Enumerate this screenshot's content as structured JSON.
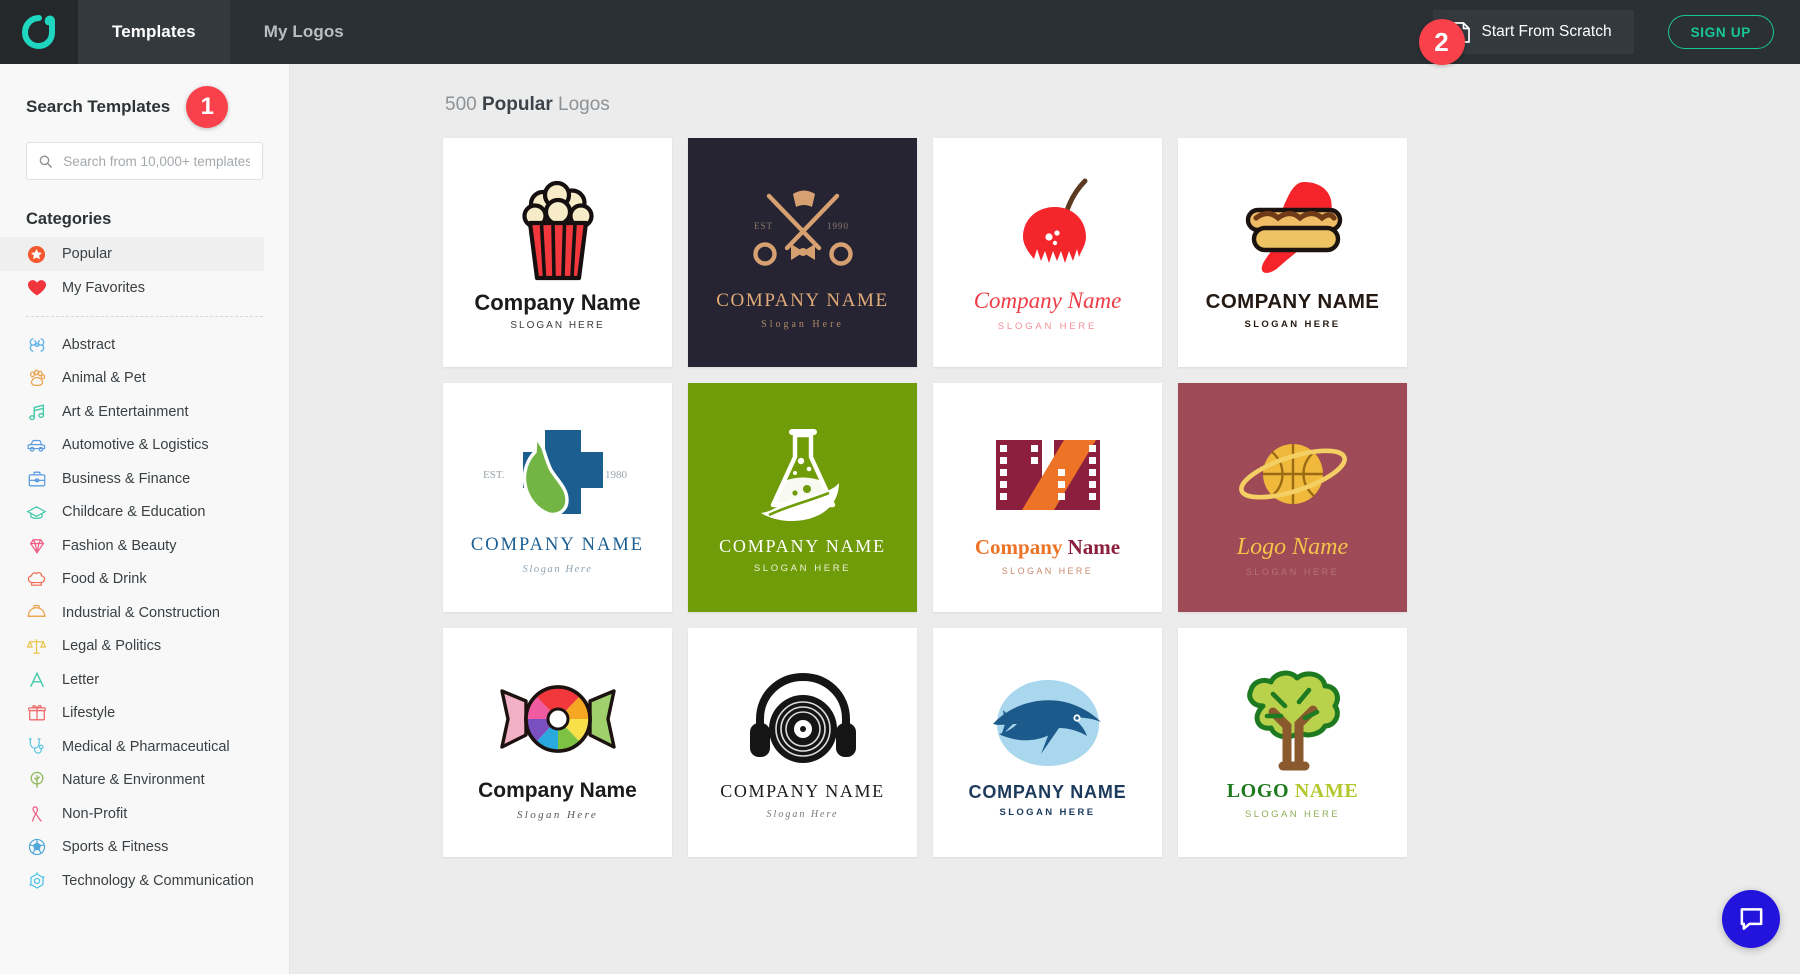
{
  "header": {
    "brand_icon": "designevo-logo-icon",
    "tabs": [
      {
        "label": "Templates",
        "active": true
      },
      {
        "label": "My Logos",
        "active": false
      }
    ],
    "badge_2": "2",
    "start_from_scratch": "Start From Scratch",
    "sign_up": "SIGN UP",
    "bg_color": "#2b3034",
    "accent_color": "#17c79a",
    "badge_color": "#f8414a"
  },
  "sidebar": {
    "title": "Search Templates",
    "badge_1": "1",
    "search": {
      "placeholder": "Search from 10,000+ templates...",
      "value": ""
    },
    "categories_title": "Categories",
    "pinned": [
      {
        "label": "Popular",
        "icon": "star-badge-icon",
        "selected": true
      },
      {
        "label": "My Favorites",
        "icon": "heart-icon",
        "selected": false
      }
    ],
    "items": [
      {
        "label": "Abstract",
        "icon": "abstract-swirl-icon",
        "color": "#63b3e8"
      },
      {
        "label": "Animal & Pet",
        "icon": "paw-print-icon",
        "color": "#eba44d"
      },
      {
        "label": "Art & Entertainment",
        "icon": "music-note-icon",
        "color": "#3fc9a8"
      },
      {
        "label": "Automotive & Logistics",
        "icon": "car-icon",
        "color": "#5d9ee0"
      },
      {
        "label": "Business & Finance",
        "icon": "briefcase-icon",
        "color": "#5d9ee0"
      },
      {
        "label": "Childcare & Education",
        "icon": "graduation-cap-icon",
        "color": "#3fc9a8"
      },
      {
        "label": "Fashion & Beauty",
        "icon": "diamond-icon",
        "color": "#ef5f86"
      },
      {
        "label": "Food & Drink",
        "icon": "chef-hat-icon",
        "color": "#ef6a52"
      },
      {
        "label": "Industrial & Construction",
        "icon": "hard-hat-icon",
        "color": "#eba44d"
      },
      {
        "label": "Legal & Politics",
        "icon": "scales-of-justice-icon",
        "color": "#e9c44a"
      },
      {
        "label": "Letter",
        "icon": "letter-a-icon",
        "color": "#3fc9a8"
      },
      {
        "label": "Lifestyle",
        "icon": "gift-box-icon",
        "color": "#ef6a6a"
      },
      {
        "label": "Medical & Pharmaceutical",
        "icon": "stethoscope-icon",
        "color": "#5dc6e0"
      },
      {
        "label": "Nature & Environment",
        "icon": "tree-icon",
        "color": "#8fb85a"
      },
      {
        "label": "Non-Profit",
        "icon": "awareness-ribbon-icon",
        "color": "#ef5f86"
      },
      {
        "label": "Sports & Fitness",
        "icon": "soccer-ball-icon",
        "color": "#4fa8d8"
      },
      {
        "label": "Technology & Communication",
        "icon": "tech-hexagon-icon",
        "color": "#4fc3e8"
      }
    ]
  },
  "main": {
    "count": "500",
    "count_category": "Popular",
    "count_suffix": "Logos",
    "cards": [
      {
        "id": "popcorn",
        "name": "Company Name",
        "slogan": "SLOGAN HERE",
        "bg": "#ffffff"
      },
      {
        "id": "barber-scissors",
        "name": "COMPANY NAME",
        "slogan": "Slogan Here",
        "est_left": "EST",
        "est_right": "1990",
        "bg": "#262433"
      },
      {
        "id": "cherry",
        "name": "Company Name",
        "slogan": "SLOGAN HERE",
        "bg": "#ffffff"
      },
      {
        "id": "hotdog",
        "name": "COMPANY NAME",
        "slogan": "SLOGAN HERE",
        "bg": "#ffffff"
      },
      {
        "id": "vet-cross",
        "name": "COMPANY NAME",
        "slogan": "Slogan Here",
        "est_left": "EST.",
        "est_right": "1980",
        "bg": "#ffffff"
      },
      {
        "id": "lab-flask",
        "name": "COMPANY NAME",
        "slogan": "SLOGAN HERE",
        "bg": "#6f9c08"
      },
      {
        "id": "film-strip",
        "name_a": "Company",
        "name_b": "Name",
        "slogan": "SLOGAN HERE",
        "bg": "#ffffff"
      },
      {
        "id": "basketball-planet",
        "name": "Logo Name",
        "slogan": "SLOGAN HERE",
        "bg": "#9e4a57"
      },
      {
        "id": "candy",
        "name": "Company Name",
        "slogan": "Slogan Here",
        "bg": "#ffffff"
      },
      {
        "id": "vinyl-headphones",
        "name": "COMPANY NAME",
        "slogan": "Slogan Here",
        "bg": "#ffffff"
      },
      {
        "id": "tuna-fish",
        "name": "COMPANY NAME",
        "slogan": "SLOGAN HERE",
        "bg": "#ffffff"
      },
      {
        "id": "tree",
        "name_a": "LOGO",
        "name_b": "NAME",
        "slogan": "SLOGAN HERE",
        "bg": "#ffffff"
      }
    ]
  },
  "chat": {
    "icon": "chat-bubble-icon",
    "color": "#2213dd"
  }
}
